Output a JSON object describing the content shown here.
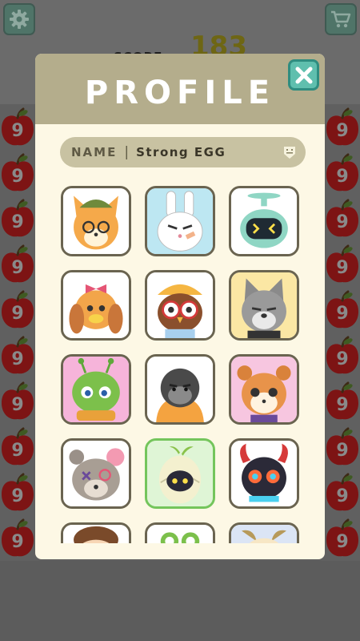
{
  "hud": {
    "score_label": "SCORE",
    "score_value": "183"
  },
  "board": {
    "apple_number": "9",
    "left_column_count": 10,
    "right_column_count": 10
  },
  "profile": {
    "title": "PROFILE",
    "name_label": "NAME",
    "name_separator": "|",
    "name_value": "Strong EGG",
    "selected_avatar": "egg"
  },
  "avatars": [
    {
      "id": "fox",
      "bg": "#ffffff"
    },
    {
      "id": "bunny",
      "bg": "#bde7f2"
    },
    {
      "id": "robot",
      "bg": "#ffffff"
    },
    {
      "id": "duck",
      "bg": "#ffffff"
    },
    {
      "id": "owl",
      "bg": "#ffffff"
    },
    {
      "id": "wolf",
      "bg": "#fbe7a4"
    },
    {
      "id": "alien",
      "bg": "#f6b4da"
    },
    {
      "id": "gorilla",
      "bg": "#ffffff"
    },
    {
      "id": "squirrel",
      "bg": "#f7c6e0"
    },
    {
      "id": "bear",
      "bg": "#ffffff"
    },
    {
      "id": "egg",
      "bg": "#dff5d6"
    },
    {
      "id": "devil",
      "bg": "#ffffff"
    },
    {
      "id": "boy",
      "bg": "#ffffff"
    },
    {
      "id": "frog",
      "bg": "#ffffff"
    },
    {
      "id": "goat",
      "bg": "#dbe5f5"
    }
  ],
  "colors": {
    "modal_bg": "#fdf8e5",
    "header_bg": "#b4ad8c",
    "accent_teal": "#5fbfae",
    "selected_border": "#74c55c"
  }
}
